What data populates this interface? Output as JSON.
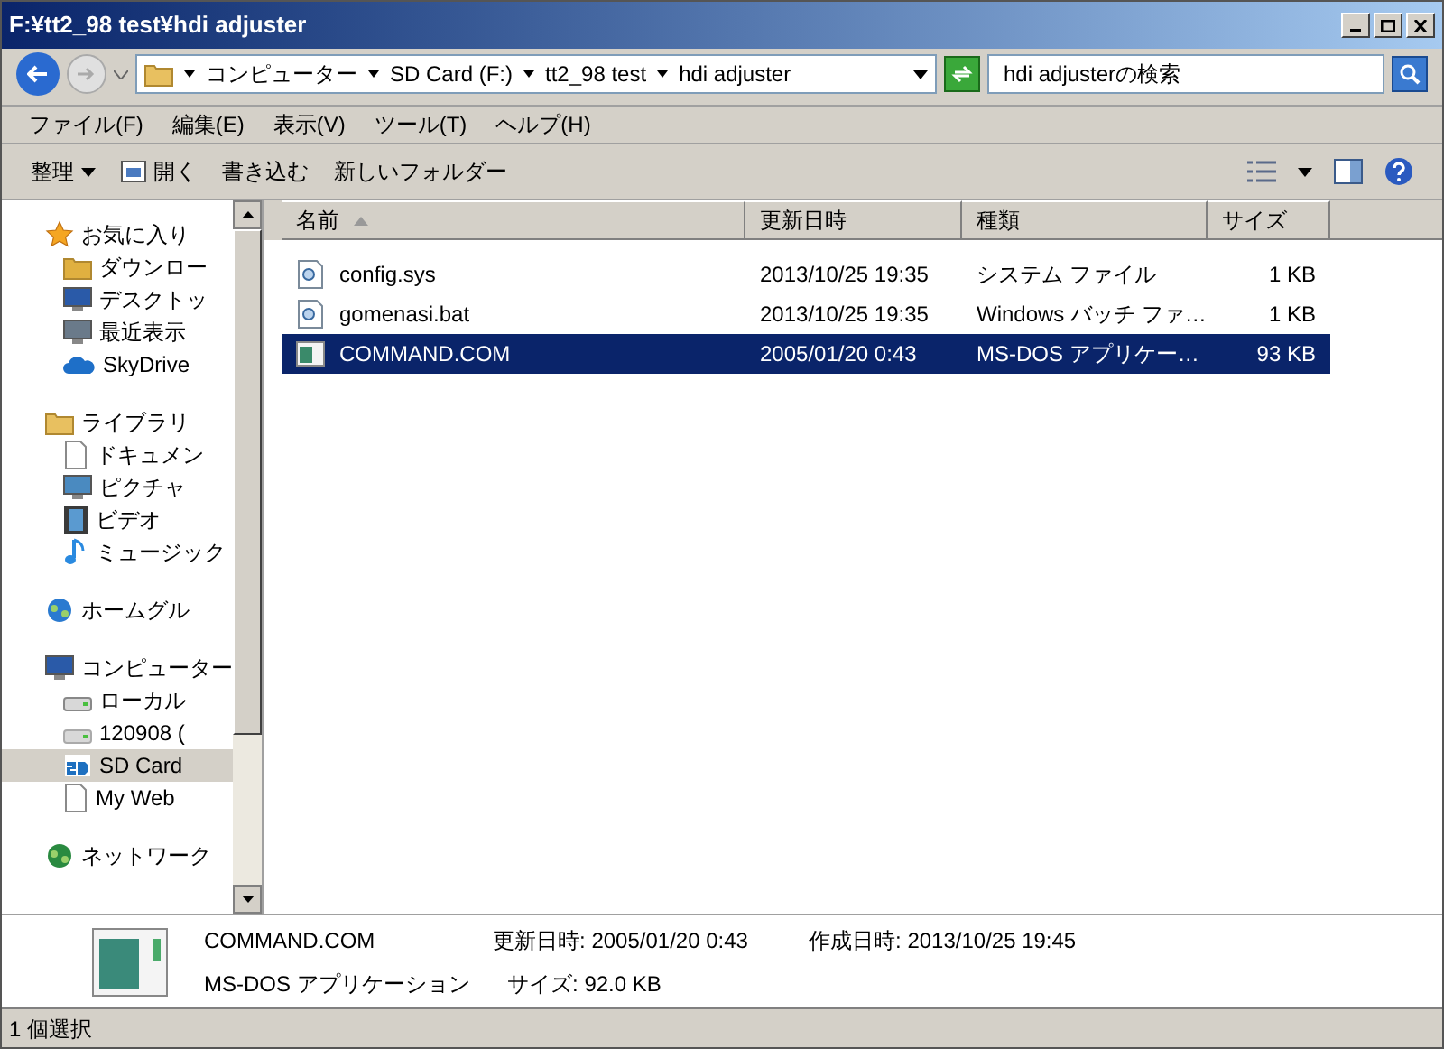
{
  "window": {
    "title": "F:¥tt2_98 test¥hdi adjuster"
  },
  "breadcrumb": [
    "コンピューター",
    "SD Card (F:)",
    "tt2_98 test",
    "hdi adjuster"
  ],
  "search": {
    "placeholder": "hdi adjusterの検索"
  },
  "menu": [
    "ファイル(F)",
    "編集(E)",
    "表示(V)",
    "ツール(T)",
    "ヘルプ(H)"
  ],
  "toolbar": [
    {
      "label": "整理",
      "kind": "dropdown"
    },
    {
      "label": "開く",
      "kind": "open"
    },
    {
      "label": "書き込む",
      "kind": "plain"
    },
    {
      "label": "新しいフォルダー",
      "kind": "plain"
    }
  ],
  "sidebar": {
    "groups": [
      {
        "label": "お気に入り",
        "kind": "star",
        "children": [
          {
            "label": "ダウンロー",
            "kind": "download",
            "selected": false
          },
          {
            "label": "デスクトッ",
            "kind": "desktop",
            "selected": false
          },
          {
            "label": "最近表示",
            "kind": "recent",
            "selected": false
          },
          {
            "label": "SkyDrive",
            "kind": "cloud",
            "selected": false
          }
        ]
      },
      {
        "label": "ライブラリ",
        "kind": "library",
        "children": [
          {
            "label": "ドキュメン",
            "kind": "doc",
            "selected": false
          },
          {
            "label": "ピクチャ",
            "kind": "picture",
            "selected": false
          },
          {
            "label": "ビデオ",
            "kind": "video",
            "selected": false
          },
          {
            "label": "ミュージック",
            "kind": "music",
            "selected": false
          }
        ]
      },
      {
        "label": "ホームグル",
        "kind": "homegroup"
      },
      {
        "label": "コンピューター",
        "kind": "computer",
        "children": [
          {
            "label": "ローカル",
            "kind": "localdisk",
            "selected": false
          },
          {
            "label": "120908 (",
            "kind": "drive",
            "selected": false
          },
          {
            "label": "SD Card",
            "kind": "sd",
            "selected": true
          },
          {
            "label": "My Web",
            "kind": "doc",
            "selected": false
          }
        ]
      },
      {
        "label": "ネットワーク",
        "kind": "network"
      }
    ]
  },
  "table": {
    "columns": [
      {
        "label": "名前",
        "sorted": true
      },
      {
        "label": "更新日時",
        "sorted": false
      },
      {
        "label": "種類",
        "sorted": false
      },
      {
        "label": "サイズ",
        "sorted": false
      }
    ],
    "rows": [
      {
        "name": "config.sys",
        "date": "2013/10/25 19:35",
        "type": "システム ファイル",
        "size": "1 KB",
        "kind": "gear",
        "selected": false
      },
      {
        "name": "gomenasi.bat",
        "date": "2013/10/25 19:35",
        "type": "Windows バッチ ファ…",
        "size": "1 KB",
        "kind": "gear",
        "selected": false
      },
      {
        "name": "COMMAND.COM",
        "date": "2005/01/20 0:43",
        "type": "MS-DOS アプリケー…",
        "size": "93 KB",
        "kind": "app",
        "selected": true
      }
    ]
  },
  "details": {
    "name": "COMMAND.COM",
    "type": "MS-DOS アプリケーション",
    "modified_label": "更新日時:",
    "modified": "2005/01/20 0:43",
    "size_label": "サイズ:",
    "size": "92.0 KB",
    "created_label": "作成日時:",
    "created": "2013/10/25 19:45"
  },
  "status_bar": "1 個選択"
}
